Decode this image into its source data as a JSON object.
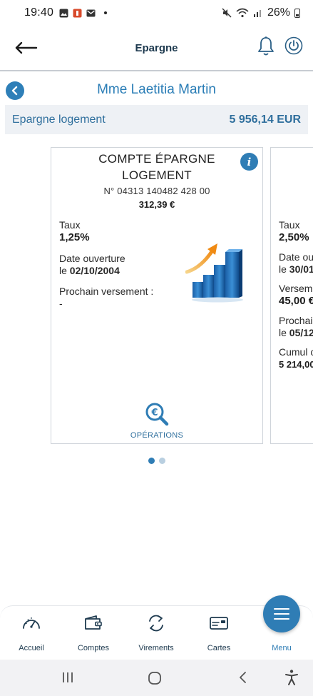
{
  "status_bar": {
    "time": "19:40",
    "battery": "26%",
    "icons": [
      "image-icon",
      "app-icon",
      "mail-icon",
      "mute-icon",
      "wifi-icon",
      "signal-icon",
      "battery-icon"
    ]
  },
  "header": {
    "title": "Epargne",
    "back_icon": "arrow-left-icon",
    "bell_icon": "bell-icon",
    "power_icon": "power-icon"
  },
  "client": {
    "name": "Mme Laetitia Martin"
  },
  "summary": {
    "label": "Epargne logement",
    "amount": "5 956,14 EUR"
  },
  "cards": [
    {
      "title_line1": "COMPTE ÉPARGNE",
      "title_line2": "LOGEMENT",
      "number": "N° 04313 140482 428 00",
      "balance": "312,39 €",
      "fields": {
        "taux_label": "Taux",
        "taux_value": "1,25%",
        "date_label": "Date ouverture",
        "date_prefix": "le ",
        "date_value": "02/10/2004",
        "prochain_label": "Prochain versement :",
        "prochain_value": "-"
      },
      "operations_label": "OPÉRATIONS"
    },
    {
      "fields": {
        "taux_label": "Taux",
        "taux_value": "2,50%",
        "date_label": "Date ou",
        "date_prefix": "le ",
        "date_value": "30/01",
        "versement_label": "Versem",
        "versement_value": "45,00 €",
        "prochain_label": "Prochai",
        "prochain_prefix": "le ",
        "prochain_value": "05/12",
        "cumul_label": "Cumul c",
        "cumul_value": "5 214,00"
      }
    }
  ],
  "pager": {
    "count": 2,
    "active": 1
  },
  "bottom_nav": {
    "items": [
      {
        "label": "Accueil",
        "icon": "speedometer-icon"
      },
      {
        "label": "Comptes",
        "icon": "wallet-icon"
      },
      {
        "label": "Virements",
        "icon": "transfer-icon"
      },
      {
        "label": "Cartes",
        "icon": "card-icon"
      },
      {
        "label": "Menu",
        "icon": "hamburger-icon"
      }
    ]
  },
  "colors": {
    "accent": "#2f7db5",
    "title_text": "#1e3a4f",
    "summary_bg": "#eef1f5"
  }
}
